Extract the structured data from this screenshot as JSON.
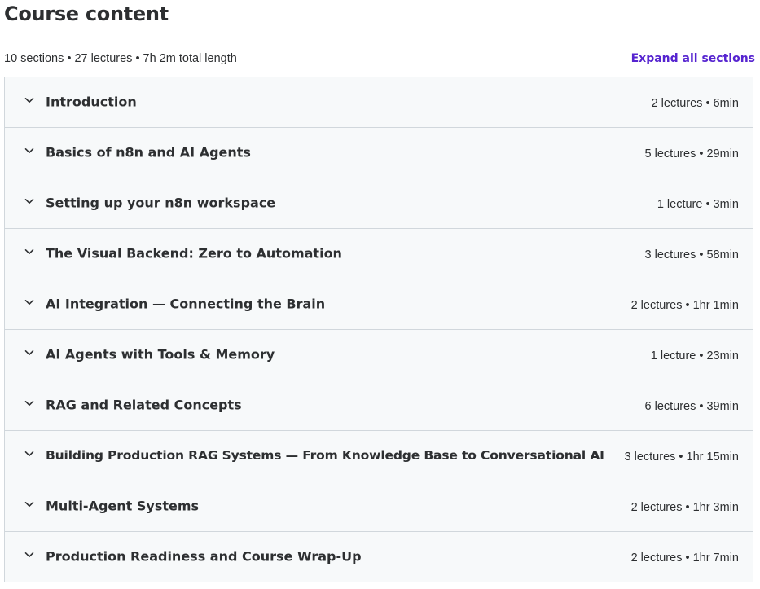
{
  "header": {
    "title": "Course content",
    "summary": "10 sections • 27 lectures • 7h 2m total length",
    "expand_label": "Expand all sections"
  },
  "icons": {
    "section_toggle": "chevron-down-icon"
  },
  "colors": {
    "accent": "#5624d0",
    "text": "#2d2f31",
    "row_background": "#f7f9fa",
    "border": "#d1d7dc"
  },
  "sections": [
    {
      "title": "Introduction",
      "meta": "2 lectures • 6min"
    },
    {
      "title": "Basics of n8n and AI Agents",
      "meta": "5 lectures • 29min"
    },
    {
      "title": "Setting up your n8n workspace",
      "meta": "1 lecture • 3min"
    },
    {
      "title": "The Visual Backend: Zero to Automation",
      "meta": "3 lectures • 58min"
    },
    {
      "title": "AI Integration — Connecting the Brain",
      "meta": "2 lectures • 1hr 1min"
    },
    {
      "title": "AI Agents with Tools & Memory",
      "meta": "1 lecture • 23min"
    },
    {
      "title": "RAG and Related Concepts",
      "meta": "6 lectures • 39min"
    },
    {
      "title": "Building Production RAG Systems — From Knowledge Base to Conversational AI",
      "meta": "3 lectures • 1hr 15min"
    },
    {
      "title": "Multi-Agent Systems",
      "meta": "2 lectures • 1hr 3min"
    },
    {
      "title": "Production Readiness and Course Wrap-Up",
      "meta": "2 lectures • 1hr 7min"
    }
  ]
}
